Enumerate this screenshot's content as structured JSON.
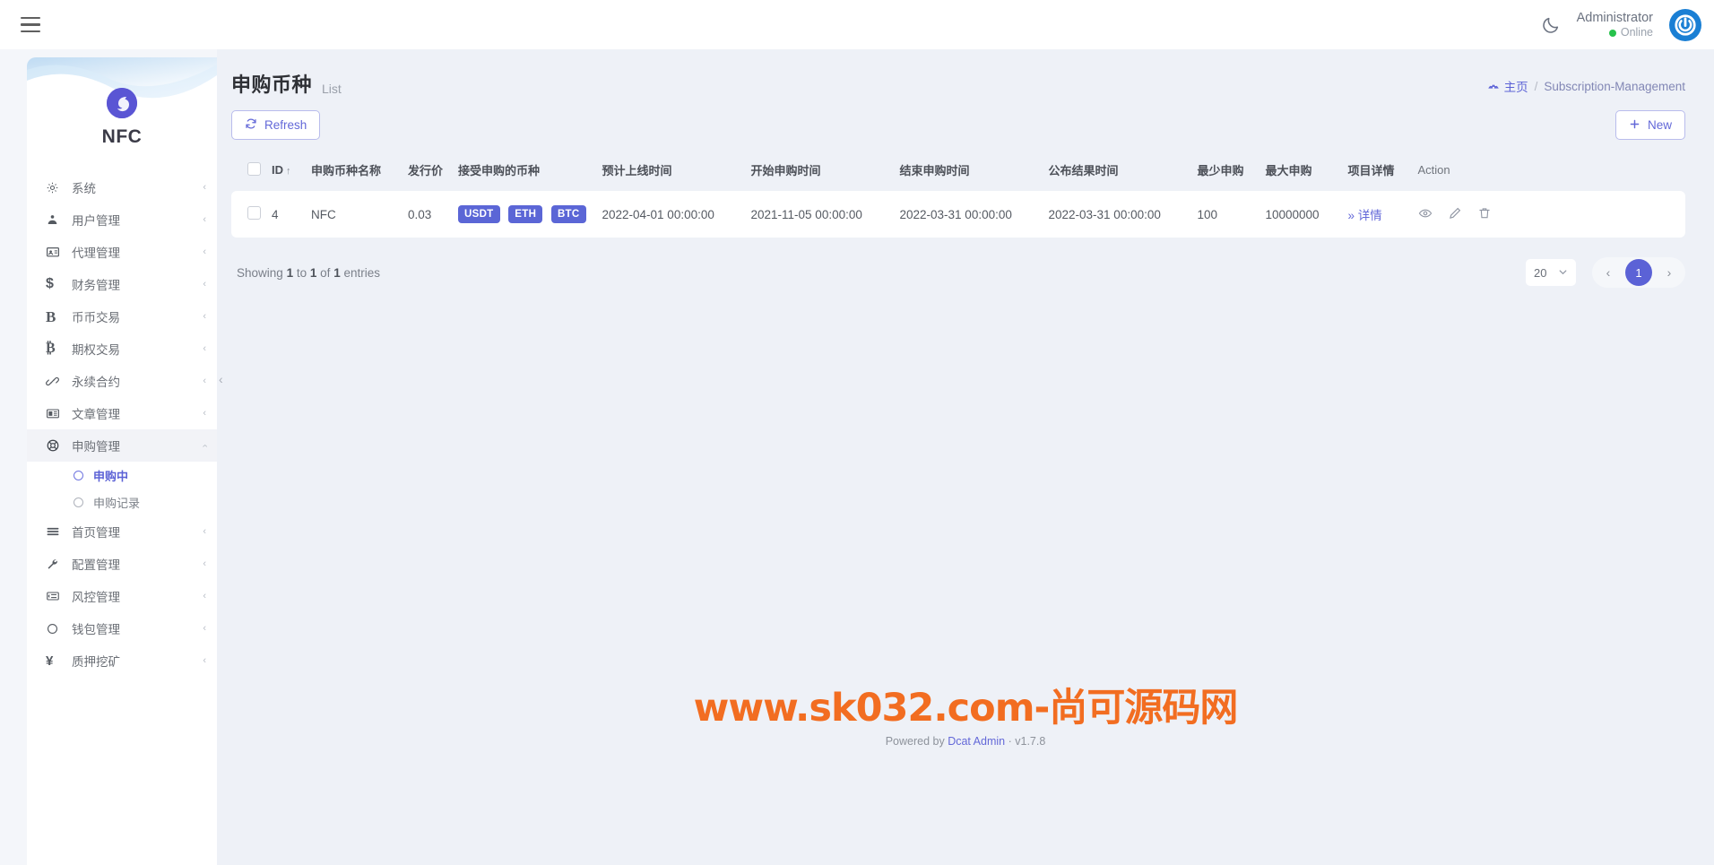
{
  "topbar": {
    "menu_icon": "hamburger-icon",
    "theme_toggle_icon": "moon-icon",
    "user_name": "Administrator",
    "user_status": "Online",
    "avatar_icon": "power-logo-icon"
  },
  "sidebar": {
    "brand": "NFC",
    "items": [
      {
        "label": "系统",
        "icon": "gear-icon",
        "chevron": "‹"
      },
      {
        "label": "用户管理",
        "icon": "user-icon",
        "chevron": "‹"
      },
      {
        "label": "代理管理",
        "icon": "id-card-icon",
        "chevron": "‹"
      },
      {
        "label": "财务管理",
        "icon": "dollar-icon",
        "chevron": "‹"
      },
      {
        "label": "币币交易",
        "icon": "bold-b-icon",
        "chevron": "‹"
      },
      {
        "label": "期权交易",
        "icon": "bitcoin-icon",
        "chevron": "‹"
      },
      {
        "label": "永续合约",
        "icon": "link-icon",
        "chevron": "‹"
      },
      {
        "label": "文章管理",
        "icon": "newspaper-icon",
        "chevron": "‹"
      },
      {
        "label": "申购管理",
        "icon": "lifebuoy-icon",
        "chevron": "‹",
        "expanded": true
      },
      {
        "label": "首页管理",
        "icon": "bars-icon",
        "chevron": "‹"
      },
      {
        "label": "配置管理",
        "icon": "wrench-icon",
        "chevron": "‹"
      },
      {
        "label": "风控管理",
        "icon": "list-alt-icon",
        "chevron": "‹"
      },
      {
        "label": "钱包管理",
        "icon": "circle-icon",
        "chevron": "‹"
      },
      {
        "label": "质押挖矿",
        "icon": "yen-icon",
        "chevron": "‹"
      }
    ],
    "submenu": [
      {
        "label": "申购中",
        "active": true
      },
      {
        "label": "申购记录",
        "active": false
      }
    ]
  },
  "page": {
    "title": "申购币种",
    "subtitle": "List",
    "breadcrumb_home": "主页",
    "breadcrumb_sep": "/",
    "breadcrumb_current": "Subscription-Management"
  },
  "toolbar": {
    "refresh_label": "Refresh",
    "refresh_icon": "refresh-icon",
    "new_label": "New",
    "new_icon": "plus-icon"
  },
  "table": {
    "columns": [
      "ID",
      "申购币种名称",
      "发行价",
      "接受申购的币种",
      "预计上线时间",
      "开始申购时间",
      "结束申购时间",
      "公布结果时间",
      "最少申购",
      "最大申购",
      "项目详情",
      "Action"
    ],
    "sort_indicator": "↑",
    "rows": [
      {
        "id": "4",
        "name": "NFC",
        "price": "0.03",
        "coins": [
          "USDT",
          "ETH",
          "BTC"
        ],
        "online_time": "2022-04-01 00:00:00",
        "start_time": "2021-11-05 00:00:00",
        "end_time": "2022-03-31 00:00:00",
        "result_time": "2022-03-31 00:00:00",
        "min_buy": "100",
        "max_buy": "10000000",
        "detail_label": "详情",
        "detail_prefix": "»",
        "actions": [
          "eye-icon",
          "pencil-icon",
          "trash-icon"
        ]
      }
    ]
  },
  "footer": {
    "showing_prefix": "Showing",
    "showing_from": "1",
    "showing_to_word": "to",
    "showing_to": "1",
    "showing_of_word": "of",
    "showing_total": "1",
    "showing_suffix": "entries",
    "per_page": "20",
    "prev_icon": "chevron-left-icon",
    "next_icon": "chevron-right-icon",
    "current_page": "1"
  },
  "branding": {
    "watermark": "www.sk032.com-尚可源码网",
    "powered_prefix": "Powered by",
    "powered_name": "Dcat Admin",
    "powered_dot": "·",
    "version": "v1.7.8"
  },
  "colors": {
    "accent": "#5b62d6",
    "badge": "#5b66d6",
    "online": "#27c24c",
    "watermark": "#f26d21",
    "avatar": "#1a7fd4"
  }
}
